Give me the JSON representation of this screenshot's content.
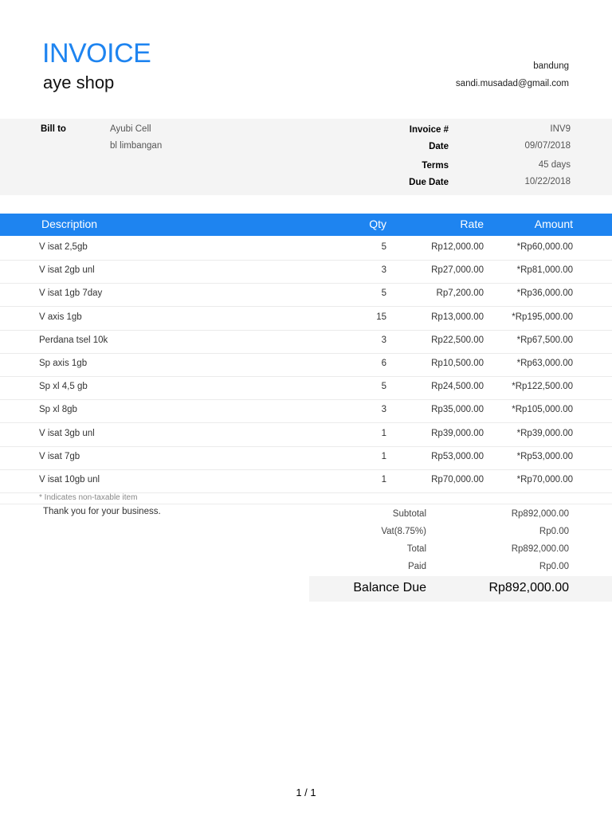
{
  "header": {
    "title": "INVOICE",
    "shop_name": "aye shop",
    "city": "bandung",
    "email": "sandi.musadad@gmail.com"
  },
  "bill": {
    "label": "Bill to",
    "name": "Ayubi Cell",
    "address": "bl limbangan",
    "invoice_no_label": "Invoice #",
    "invoice_no": "INV9",
    "date_label": "Date",
    "date": "09/07/2018",
    "terms_label": "Terms",
    "terms": "45 days",
    "due_label": "Due Date",
    "due": "10/22/2018"
  },
  "table": {
    "headers": {
      "description": "Description",
      "qty": "Qty",
      "rate": "Rate",
      "amount": "Amount"
    },
    "rows": [
      {
        "description": "V isat 2,5gb",
        "qty": "5",
        "rate": "Rp12,000.00",
        "amount": "*Rp60,000.00"
      },
      {
        "description": "V isat 2gb unl",
        "qty": "3",
        "rate": "Rp27,000.00",
        "amount": "*Rp81,000.00"
      },
      {
        "description": "V isat 1gb 7day",
        "qty": "5",
        "rate": "Rp7,200.00",
        "amount": "*Rp36,000.00"
      },
      {
        "description": "V axis 1gb",
        "qty": "15",
        "rate": "Rp13,000.00",
        "amount": "*Rp195,000.00"
      },
      {
        "description": "Perdana tsel 10k",
        "qty": "3",
        "rate": "Rp22,500.00",
        "amount": "*Rp67,500.00"
      },
      {
        "description": "Sp axis 1gb",
        "qty": "6",
        "rate": "Rp10,500.00",
        "amount": "*Rp63,000.00"
      },
      {
        "description": "Sp xl 4,5 gb",
        "qty": "5",
        "rate": "Rp24,500.00",
        "amount": "*Rp122,500.00"
      },
      {
        "description": "Sp xl 8gb",
        "qty": "3",
        "rate": "Rp35,000.00",
        "amount": "*Rp105,000.00"
      },
      {
        "description": "V isat 3gb unl",
        "qty": "1",
        "rate": "Rp39,000.00",
        "amount": "*Rp39,000.00"
      },
      {
        "description": "V isat 7gb",
        "qty": "1",
        "rate": "Rp53,000.00",
        "amount": "*Rp53,000.00"
      },
      {
        "description": "V isat 10gb unl",
        "qty": "1",
        "rate": "Rp70,000.00",
        "amount": "*Rp70,000.00"
      }
    ],
    "note": "* Indicates non-taxable item"
  },
  "footer": {
    "thanks": "Thank you for your business."
  },
  "totals": {
    "subtotal_label": "Subtotal",
    "subtotal": "Rp892,000.00",
    "vat_label": "Vat(8.75%)",
    "vat": "Rp0.00",
    "total_label": "Total",
    "total": "Rp892,000.00",
    "paid_label": "Paid",
    "paid": "Rp0.00",
    "balance_label": "Balance Due",
    "balance": "Rp892,000.00"
  },
  "pager": "1 / 1",
  "colors": {
    "accent": "#1e84f0",
    "band": "#f4f4f4"
  }
}
